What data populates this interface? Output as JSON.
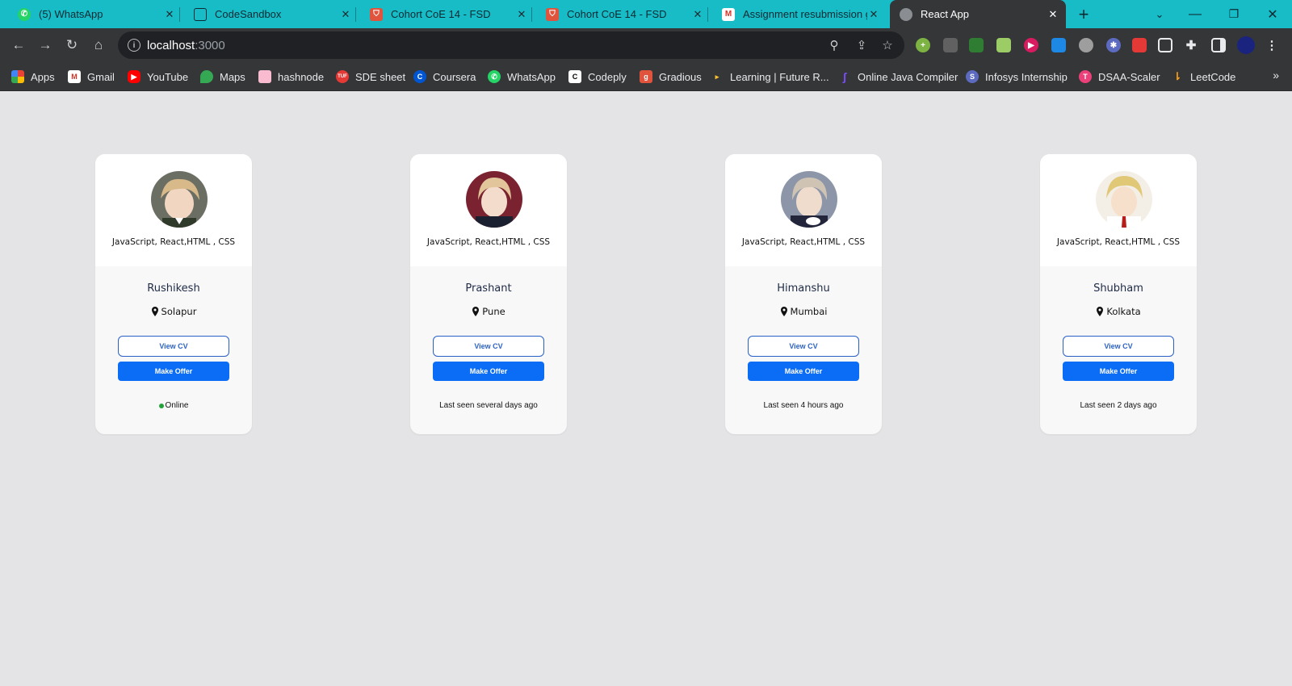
{
  "browser": {
    "tabs": [
      {
        "title": "(5) WhatsApp",
        "icon": "whatsapp-icon",
        "active": false
      },
      {
        "title": "CodeSandbox",
        "icon": "codesandbox-icon",
        "active": false
      },
      {
        "title": "Cohort CoE 14 - FSD",
        "icon": "shield-icon",
        "active": false
      },
      {
        "title": "Cohort CoE 14 - FSD",
        "icon": "shield-icon",
        "active": false
      },
      {
        "title": "Assignment resubmission g",
        "icon": "gmail-icon",
        "active": false
      },
      {
        "title": "React App",
        "icon": "globe-icon",
        "active": true
      }
    ],
    "url_host": "localhost",
    "url_port": ":3000",
    "bookmarks": [
      {
        "label": "Apps",
        "icon": "apps-grid-icon"
      },
      {
        "label": "Gmail",
        "icon": "gmail-icon"
      },
      {
        "label": "YouTube",
        "icon": "youtube-icon"
      },
      {
        "label": "Maps",
        "icon": "maps-icon"
      },
      {
        "label": "hashnode",
        "icon": "hashnode-icon"
      },
      {
        "label": "SDE sheet",
        "icon": "tuf-icon"
      },
      {
        "label": "Coursera",
        "icon": "coursera-icon"
      },
      {
        "label": "WhatsApp",
        "icon": "whatsapp-icon"
      },
      {
        "label": "Codeply",
        "icon": "codeply-icon"
      },
      {
        "label": "Gradious",
        "icon": "gradious-icon"
      },
      {
        "label": "Learning | Future R...",
        "icon": "play-icon"
      },
      {
        "label": "Online Java Compiler",
        "icon": "java-compiler-icon"
      },
      {
        "label": "Infosys Internship",
        "icon": "infosys-icon"
      },
      {
        "label": "DSAA-Scaler",
        "icon": "scaler-icon"
      },
      {
        "label": "LeetCode",
        "icon": "leetcode-icon"
      }
    ],
    "more_bookmarks": "»"
  },
  "cards": [
    {
      "skills": "JavaScript, React,HTML , CSS",
      "name": "Rushikesh",
      "location": "Solapur",
      "view_cv": "View CV",
      "make_offer": "Make Offer",
      "status": "Online",
      "online": true
    },
    {
      "skills": "JavaScript, React,HTML , CSS",
      "name": "Prashant",
      "location": "Pune",
      "view_cv": "View CV",
      "make_offer": "Make Offer",
      "status": "Last seen several days ago",
      "online": false
    },
    {
      "skills": "JavaScript, React,HTML , CSS",
      "name": "Himanshu",
      "location": "Mumbai",
      "view_cv": "View CV",
      "make_offer": "Make Offer",
      "status": "Last seen 4 hours ago",
      "online": false
    },
    {
      "skills": "JavaScript, React,HTML , CSS",
      "name": "Shubham",
      "location": "Kolkata",
      "view_cv": "View CV",
      "make_offer": "Make Offer",
      "status": "Last seen 2 days ago",
      "online": false
    }
  ],
  "colors": {
    "tabstrip": "#17bcc7",
    "toolbar": "#353638",
    "page_bg": "#e4e4e6",
    "primary_button": "#0b6cf5",
    "online_dot": "#23a23a"
  }
}
